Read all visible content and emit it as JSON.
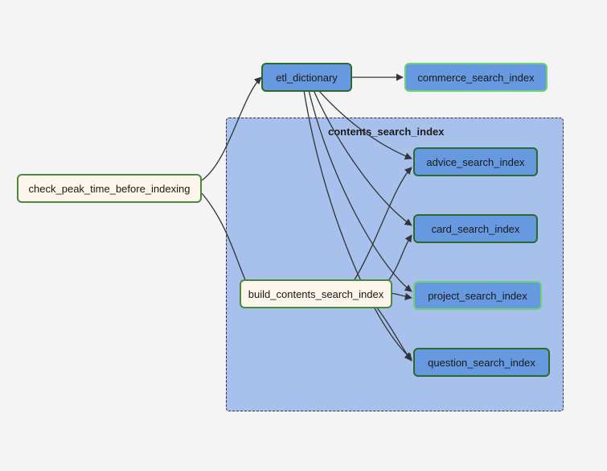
{
  "nodes": {
    "check_peak": "check_peak_time_before_indexing",
    "etl_dictionary": "etl_dictionary",
    "commerce_index": "commerce_search_index",
    "build_contents": "build_contents_search_index",
    "advice_index": "advice_search_index",
    "card_index": "card_search_index",
    "project_index": "project_search_index",
    "question_index": "question_search_index"
  },
  "group": {
    "title": "contents_search_index"
  },
  "chart_data": {
    "type": "diagram",
    "title": "",
    "nodes": [
      {
        "id": "check_peak_time_before_indexing",
        "style": "cream"
      },
      {
        "id": "etl_dictionary",
        "style": "blue-dark"
      },
      {
        "id": "commerce_search_index",
        "style": "blue-light"
      },
      {
        "id": "build_contents_search_index",
        "style": "cream",
        "group": "contents_search_index"
      },
      {
        "id": "advice_search_index",
        "style": "blue-dark",
        "group": "contents_search_index"
      },
      {
        "id": "card_search_index",
        "style": "blue-dark",
        "group": "contents_search_index"
      },
      {
        "id": "project_search_index",
        "style": "blue-light",
        "group": "contents_search_index"
      },
      {
        "id": "question_search_index",
        "style": "blue-dark",
        "group": "contents_search_index"
      }
    ],
    "edges": [
      {
        "from": "check_peak_time_before_indexing",
        "to": "etl_dictionary"
      },
      {
        "from": "check_peak_time_before_indexing",
        "to": "build_contents_search_index"
      },
      {
        "from": "etl_dictionary",
        "to": "commerce_search_index"
      },
      {
        "from": "etl_dictionary",
        "to": "advice_search_index"
      },
      {
        "from": "etl_dictionary",
        "to": "card_search_index"
      },
      {
        "from": "etl_dictionary",
        "to": "project_search_index"
      },
      {
        "from": "etl_dictionary",
        "to": "question_search_index"
      },
      {
        "from": "build_contents_search_index",
        "to": "advice_search_index"
      },
      {
        "from": "build_contents_search_index",
        "to": "card_search_index"
      },
      {
        "from": "build_contents_search_index",
        "to": "project_search_index"
      },
      {
        "from": "build_contents_search_index",
        "to": "question_search_index"
      }
    ],
    "groups": [
      {
        "id": "contents_search_index",
        "members": [
          "build_contents_search_index",
          "advice_search_index",
          "card_search_index",
          "project_search_index",
          "question_search_index"
        ]
      }
    ]
  }
}
